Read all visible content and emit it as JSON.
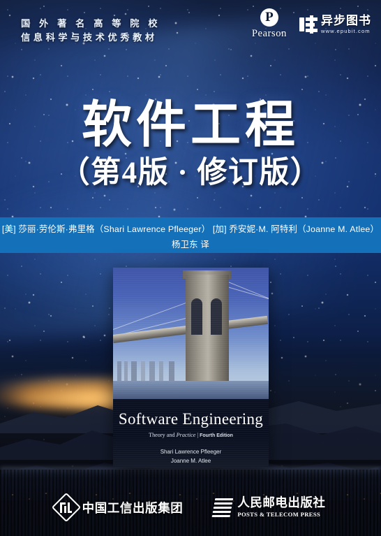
{
  "header": {
    "series_line1": "国 外 著 名 高 等 院 校",
    "series_line2": "信息科学与技术优秀教材",
    "pearson": {
      "mark_letter": "P",
      "wordmark": "Pearson"
    },
    "epubit": {
      "cn_name": "异步图书",
      "url": "www.epubit.com"
    }
  },
  "title": {
    "main": "软件工程",
    "edition": "（第4版 · 修订版）"
  },
  "authors": {
    "line1": "[美] 莎丽·劳伦斯·弗里格（Shari Lawrence Pfleeger）  [加] 乔安妮·M. 阿特利（Joanne M. Atlee）",
    "line2": "杨卫东 译"
  },
  "inset_book": {
    "title": "Software Engineering",
    "subtitle_part1": "Theory and ",
    "subtitle_italic": "Practice",
    "subtitle_sep": "  |  ",
    "subtitle_edition": "Fourth Edition",
    "author1": "Shari Lawrence Pfleeger",
    "author2": "Joanne M. Atlee"
  },
  "footer": {
    "publisher1": "中国工信出版集团",
    "publisher2_cn": "人民邮电出版社",
    "publisher2_en": "POSTS & TELECOM PRESS"
  },
  "colors": {
    "author_band_blue": "#1470b8",
    "sky_deep_navy": "#121f3d",
    "sky_mid_blue": "#17306b",
    "sunset_amber": "#e8a650",
    "text_white": "#ffffff"
  }
}
